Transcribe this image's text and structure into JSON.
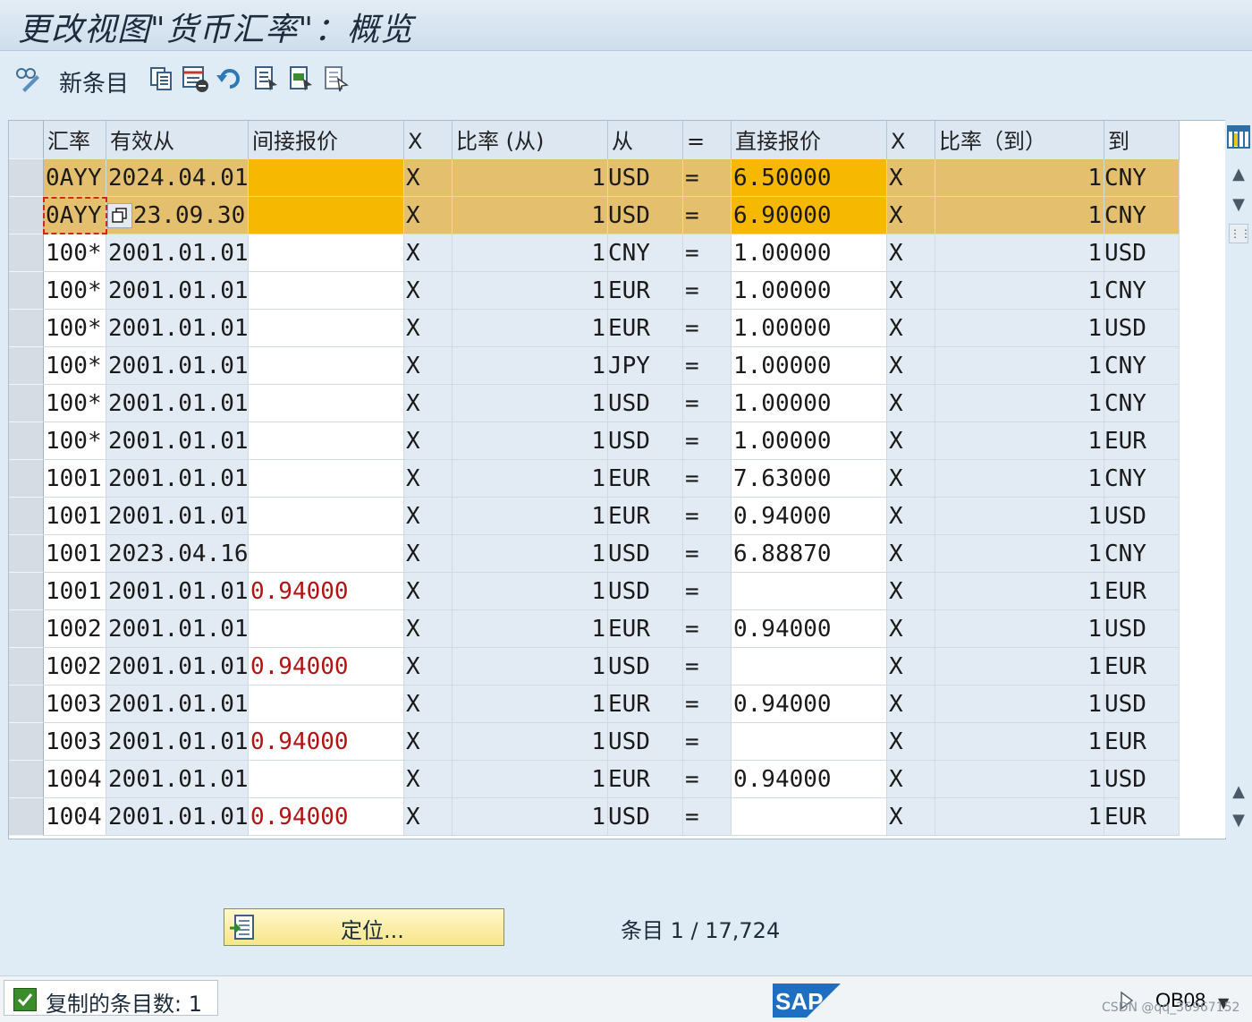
{
  "window": {
    "title": "更改视图\"货币汇率\"：概览"
  },
  "toolbar": {
    "new_entries_label": "新条目",
    "icons": [
      "display-change-icon",
      "copy-icon",
      "delete-icon",
      "undo-icon",
      "select-all-icon",
      "select-block-icon",
      "deselect-all-icon"
    ]
  },
  "table": {
    "headers": [
      "汇率",
      "有效从",
      "间接报价",
      "X",
      "比率 (从)",
      "从",
      "=",
      "直接报价",
      "X",
      "比率（到）",
      "到"
    ],
    "rows": [
      {
        "rate": "0AYY",
        "valid_from": "2024.04.01",
        "indirect": "",
        "x1": "X",
        "ratio_from": "1",
        "from": "USD",
        "eq": "=",
        "direct": "6.50000",
        "x2": "X",
        "ratio_to": "1",
        "to": "CNY",
        "selected": true
      },
      {
        "rate": "0AYY",
        "valid_from": "2023.09.30",
        "indirect": "",
        "x1": "X",
        "ratio_from": "1",
        "from": "USD",
        "eq": "=",
        "direct": "6.90000",
        "x2": "X",
        "ratio_to": "1",
        "to": "CNY",
        "selected": true
      },
      {
        "rate": "100*",
        "valid_from": "2001.01.01",
        "indirect": "",
        "x1": "X",
        "ratio_from": "1",
        "from": "CNY",
        "eq": "=",
        "direct": "1.00000",
        "x2": "X",
        "ratio_to": "1",
        "to": "USD"
      },
      {
        "rate": "100*",
        "valid_from": "2001.01.01",
        "indirect": "",
        "x1": "X",
        "ratio_from": "1",
        "from": "EUR",
        "eq": "=",
        "direct": "1.00000",
        "x2": "X",
        "ratio_to": "1",
        "to": "CNY"
      },
      {
        "rate": "100*",
        "valid_from": "2001.01.01",
        "indirect": "",
        "x1": "X",
        "ratio_from": "1",
        "from": "EUR",
        "eq": "=",
        "direct": "1.00000",
        "x2": "X",
        "ratio_to": "1",
        "to": "USD"
      },
      {
        "rate": "100*",
        "valid_from": "2001.01.01",
        "indirect": "",
        "x1": "X",
        "ratio_from": "1",
        "from": "JPY",
        "eq": "=",
        "direct": "1.00000",
        "x2": "X",
        "ratio_to": "1",
        "to": "CNY"
      },
      {
        "rate": "100*",
        "valid_from": "2001.01.01",
        "indirect": "",
        "x1": "X",
        "ratio_from": "1",
        "from": "USD",
        "eq": "=",
        "direct": "1.00000",
        "x2": "X",
        "ratio_to": "1",
        "to": "CNY"
      },
      {
        "rate": "100*",
        "valid_from": "2001.01.01",
        "indirect": "",
        "x1": "X",
        "ratio_from": "1",
        "from": "USD",
        "eq": "=",
        "direct": "1.00000",
        "x2": "X",
        "ratio_to": "1",
        "to": "EUR"
      },
      {
        "rate": "1001",
        "valid_from": "2001.01.01",
        "indirect": "",
        "x1": "X",
        "ratio_from": "1",
        "from": "EUR",
        "eq": "=",
        "direct": "7.63000",
        "x2": "X",
        "ratio_to": "1",
        "to": "CNY"
      },
      {
        "rate": "1001",
        "valid_from": "2001.01.01",
        "indirect": "",
        "x1": "X",
        "ratio_from": "1",
        "from": "EUR",
        "eq": "=",
        "direct": "0.94000",
        "x2": "X",
        "ratio_to": "1",
        "to": "USD"
      },
      {
        "rate": "1001",
        "valid_from": "2023.04.16",
        "indirect": "",
        "x1": "X",
        "ratio_from": "1",
        "from": "USD",
        "eq": "=",
        "direct": "6.88870",
        "x2": "X",
        "ratio_to": "1",
        "to": "CNY"
      },
      {
        "rate": "1001",
        "valid_from": "2001.01.01",
        "indirect": "0.94000",
        "x1": "X",
        "ratio_from": "1",
        "from": "USD",
        "eq": "=",
        "direct": "",
        "x2": "X",
        "ratio_to": "1",
        "to": "EUR"
      },
      {
        "rate": "1002",
        "valid_from": "2001.01.01",
        "indirect": "",
        "x1": "X",
        "ratio_from": "1",
        "from": "EUR",
        "eq": "=",
        "direct": "0.94000",
        "x2": "X",
        "ratio_to": "1",
        "to": "USD"
      },
      {
        "rate": "1002",
        "valid_from": "2001.01.01",
        "indirect": "0.94000",
        "x1": "X",
        "ratio_from": "1",
        "from": "USD",
        "eq": "=",
        "direct": "",
        "x2": "X",
        "ratio_to": "1",
        "to": "EUR"
      },
      {
        "rate": "1003",
        "valid_from": "2001.01.01",
        "indirect": "",
        "x1": "X",
        "ratio_from": "1",
        "from": "EUR",
        "eq": "=",
        "direct": "0.94000",
        "x2": "X",
        "ratio_to": "1",
        "to": "USD"
      },
      {
        "rate": "1003",
        "valid_from": "2001.01.01",
        "indirect": "0.94000",
        "x1": "X",
        "ratio_from": "1",
        "from": "USD",
        "eq": "=",
        "direct": "",
        "x2": "X",
        "ratio_to": "1",
        "to": "EUR"
      },
      {
        "rate": "1004",
        "valid_from": "2001.01.01",
        "indirect": "",
        "x1": "X",
        "ratio_from": "1",
        "from": "EUR",
        "eq": "=",
        "direct": "0.94000",
        "x2": "X",
        "ratio_to": "1",
        "to": "USD"
      },
      {
        "rate": "1004",
        "valid_from": "2001.01.01",
        "indirect": "0.94000",
        "x1": "X",
        "ratio_from": "1",
        "from": "USD",
        "eq": "=",
        "direct": "",
        "x2": "X",
        "ratio_to": "1",
        "to": "EUR"
      }
    ]
  },
  "footer": {
    "position_button_label": "定位...",
    "entries_text": "条目 1 / 17,724"
  },
  "statusbar": {
    "message": "复制的条目数: 1",
    "sap_logo": "SAP",
    "transaction": "OB08",
    "watermark": "CSDN @qq_36967152"
  },
  "colors": {
    "selected_row": "#e4bf6e",
    "selected_input": "#f6b800",
    "indirect_text": "#b21414"
  }
}
